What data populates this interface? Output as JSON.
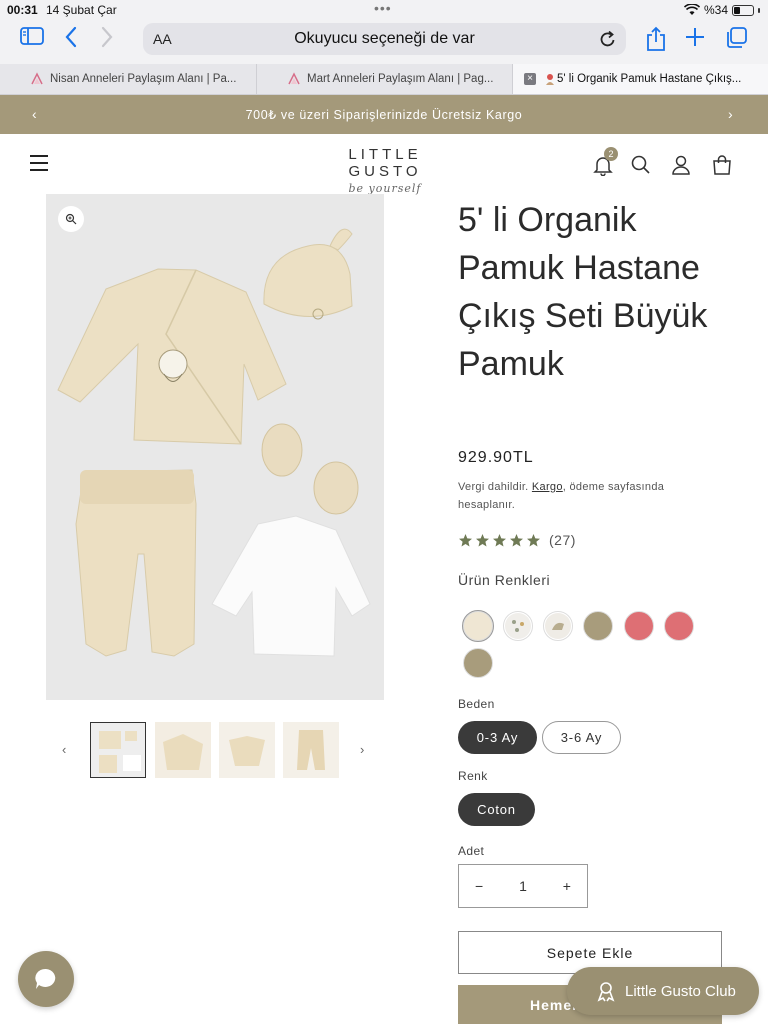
{
  "status_bar": {
    "time": "00:31",
    "date": "14 Şubat Çar",
    "battery": "%34"
  },
  "browser": {
    "address_text_size": "AA",
    "address_text": "Okuyucu seçeneği de var",
    "tabs": [
      {
        "label": "Nisan Anneleri Paylaşım Alanı | Pa...",
        "active": false
      },
      {
        "label": "Mart Anneleri Paylaşım Alanı | Pag...",
        "active": false
      },
      {
        "label": "5' li Organik Pamuk Hastane Çıkış...",
        "active": true
      }
    ]
  },
  "announcement": {
    "text": "700₺ ve üzeri Siparişlerinizde Ücretsiz Kargo"
  },
  "header": {
    "logo": "LITTLE GUSTO",
    "logo_tagline": "be yourself",
    "notification_count": "2"
  },
  "product": {
    "title": "5' li Organik Pamuk Hastane Çıkış Seti Büyük Pamuk",
    "price": "929.90TL",
    "tax_note_prefix": "Vergi dahildir.",
    "tax_note_link": "Kargo",
    "tax_note_suffix": ", ödeme sayfasında hesaplanır.",
    "rating_count": "(27)",
    "rating_stars": 5,
    "colors_heading": "Ürün Renkleri",
    "swatches": [
      "#efe6d3",
      "#f0eeea",
      "#efece6",
      "#a89c7c",
      "#de6f74",
      "#de6f74",
      "#a89c7c"
    ],
    "size_label": "Beden",
    "sizes": [
      "0-3 Ay",
      "3-6 Ay"
    ],
    "selected_size": "0-3 Ay",
    "color_label": "Renk",
    "color_value": "Coton",
    "qty_label": "Adet",
    "qty_minus": "−",
    "qty_value": "1",
    "qty_plus": "+",
    "add_to_cart": "Sepete Ekle",
    "buy_now": "Hemen"
  },
  "floating": {
    "club_label": "Little Gusto Club"
  },
  "colors": {
    "brand": "#a4997a",
    "dark_pill": "#3a3a3a",
    "ios_blue": "#1a73e8"
  }
}
